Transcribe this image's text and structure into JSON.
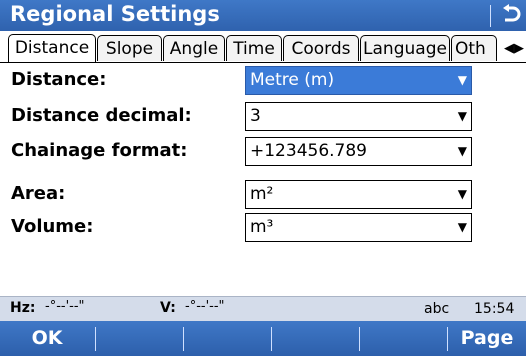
{
  "window": {
    "title": "Regional Settings",
    "back_icon": "return-arrow-icon"
  },
  "tabs": [
    {
      "label": "Distance",
      "active": true
    },
    {
      "label": "Slope"
    },
    {
      "label": "Angle"
    },
    {
      "label": "Time"
    },
    {
      "label": "Coords"
    },
    {
      "label": "Language"
    },
    {
      "label": "Oth"
    }
  ],
  "tab_scroll": {
    "left_icon": "scroll-left-icon",
    "right_icon": "scroll-right-icon"
  },
  "form": {
    "distance": {
      "label": "Distance:",
      "value": "Metre (m)"
    },
    "decimal": {
      "label": "Distance decimal:",
      "value": "3"
    },
    "chainage": {
      "label": "Chainage format:",
      "value": "+123456.789"
    },
    "area": {
      "label": "Area:",
      "value": "m²"
    },
    "volume": {
      "label": "Volume:",
      "value": "m³"
    }
  },
  "status": {
    "hz_label": "Hz:",
    "hz_value": "-°--'--\"",
    "v_label": "V:",
    "v_value": "-°--'--\"",
    "input_mode": "abc",
    "time": "15:54"
  },
  "softkeys": {
    "f1": "OK",
    "f2": "",
    "f3": "",
    "f4": "",
    "f5": "",
    "f6": "Page"
  },
  "colors": {
    "accent": "#3569b8",
    "selection": "#3b7bd8",
    "status_bg": "#d4dcea"
  }
}
